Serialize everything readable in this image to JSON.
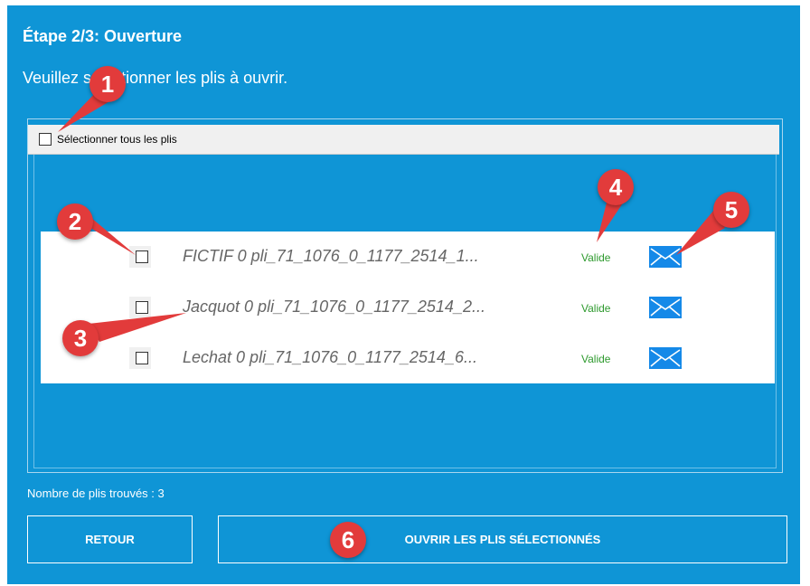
{
  "page": {
    "title": "Étape 2/3: Ouverture",
    "subtitle": "Veuillez sélectionner les plis à ouvrir."
  },
  "list": {
    "select_all_label": "Sélectionner tous les plis",
    "rows": [
      {
        "name": "FICTIF 0 pli_71_1076_0_1177_2514_1...",
        "status": "Valide",
        "checked": false
      },
      {
        "name": "Jacquot 0 pli_71_1076_0_1177_2514_2...",
        "status": "Valide",
        "checked": false
      },
      {
        "name": "Lechat 0 pli_71_1076_0_1177_2514_6...",
        "status": "Valide",
        "checked": false
      }
    ]
  },
  "footer": {
    "count_text": "Nombre de plis trouvés : 3",
    "back_label": "RETOUR",
    "open_label": "OUVRIR LES PLIS SÉLECTIONNÉS"
  },
  "annotations": [
    "1",
    "2",
    "3",
    "4",
    "5",
    "6"
  ],
  "colors": {
    "panel": "#0f95d6",
    "status_valid": "#2e9a2e",
    "envelope": "#1589e8",
    "badge": "#e23b3b"
  },
  "icons": {
    "row_action": "envelope-icon"
  }
}
